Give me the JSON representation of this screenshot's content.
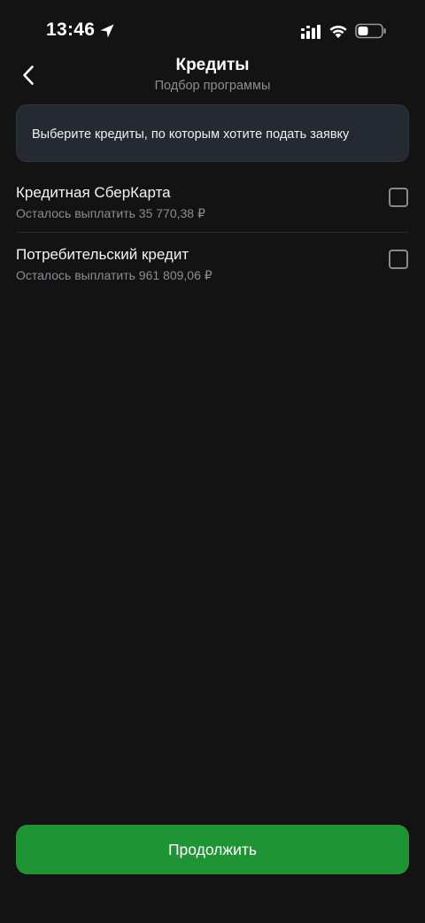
{
  "status_bar": {
    "time": "13:46",
    "icons": [
      "location-arrow-icon",
      "signal-icon",
      "wifi-icon",
      "battery-icon"
    ]
  },
  "header": {
    "title": "Кредиты",
    "subtitle": "Подбор программы",
    "back_icon": "chevron-left-icon"
  },
  "info": {
    "text": "Выберите кредиты, по которым хотите подать заявку"
  },
  "credits": [
    {
      "name": "Кредитная СберКарта",
      "remaining": "Осталось выплатить 35 770,38 ₽",
      "checked": false
    },
    {
      "name": "Потребительский кредит",
      "remaining": "Осталось выплатить 961 809,06 ₽",
      "checked": false
    }
  ],
  "actions": {
    "continue_label": "Продолжить"
  },
  "colors": {
    "background": "#131313",
    "card": "#252932",
    "accent": "#1e9435",
    "secondary_text": "#8d8d92"
  }
}
